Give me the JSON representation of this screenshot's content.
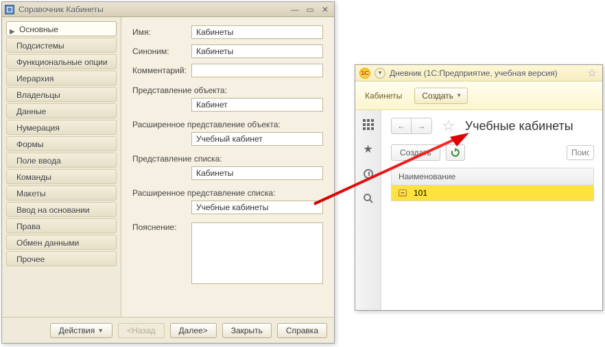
{
  "designer": {
    "title": "Справочник Кабинеты",
    "nav": [
      "Основные",
      "Подсистемы",
      "Функциональные опции",
      "Иерархия",
      "Владельцы",
      "Данные",
      "Нумерация",
      "Формы",
      "Поле ввода",
      "Команды",
      "Макеты",
      "Ввод на основании",
      "Права",
      "Обмен данными",
      "Прочее"
    ],
    "fields": {
      "name_label": "Имя:",
      "name": "Кабинеты",
      "synonym_label": "Синоним:",
      "synonym": "Кабинеты",
      "comment_label": "Комментарий:",
      "comment": "",
      "obj_repr_label": "Представление объекта:",
      "obj_repr": "Кабинет",
      "obj_repr_ext_label": "Расширенное представление объекта:",
      "obj_repr_ext": "Учебный кабинет",
      "list_repr_label": "Представление списка:",
      "list_repr": "Кабинеты",
      "list_repr_ext_label": "Расширенное представление списка:",
      "list_repr_ext": "Учебные кабинеты",
      "explain_label": "Пояснение:",
      "explain": ""
    },
    "footer": {
      "actions": "Действия",
      "back": "<Назад",
      "next": "Далее>",
      "close": "Закрыть",
      "help": "Справка"
    }
  },
  "runtime": {
    "title": "Дневник  (1С:Предприятие, учебная версия)",
    "strip": {
      "tab": "Кабинеты",
      "create": "Создать"
    },
    "heading": "Учебные кабинеты",
    "toolbar": {
      "create": "Создать",
      "search_placeholder": "Поиск"
    },
    "table": {
      "header": "Наименование",
      "rows": [
        "101"
      ]
    }
  }
}
